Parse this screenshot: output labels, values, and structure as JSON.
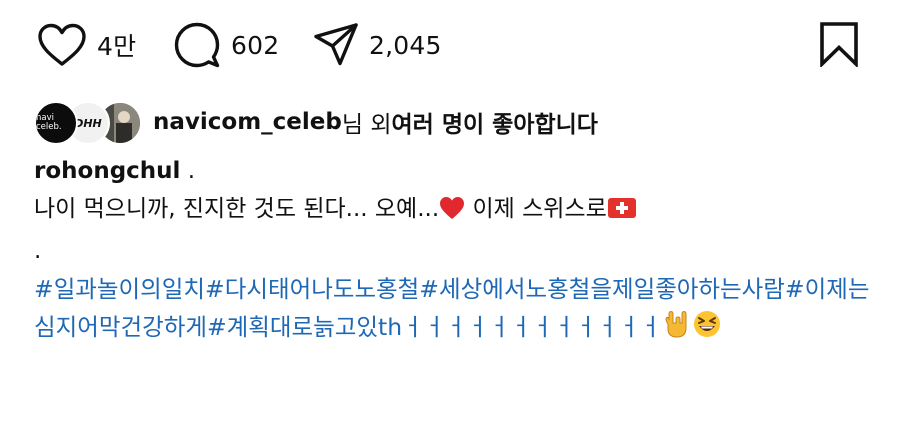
{
  "actions": {
    "like_count": "4만",
    "comment_count": "602",
    "share_count": "2,045"
  },
  "likes": {
    "first_user": "navicom_celeb",
    "suffix_plain": "님 외 ",
    "suffix_bold": "여러 명이 좋아합니다"
  },
  "caption": {
    "username": "rohongchul",
    "username_suffix": " .",
    "line1_text": "나이 먹으니까, 진지한 것도 된다... 오예...",
    "line1_after_heart": " 이제 스위스로",
    "dot_line": ".",
    "hashtags": "#일과놀이의일치#다시태어나도노홍철#세상에서노홍철을제일좋아하는사람#이제는심지어막건강하게#계획대로늙고있th",
    "trailing": "ㅓㅓㅓㅓㅓㅓㅓㅓㅓㅓㅓㅓ"
  },
  "avatar_labels": {
    "first": "navi celeb.",
    "second": "DHH"
  },
  "icons": {
    "like": "heart-icon",
    "comment": "comment-bubble-icon",
    "share": "paper-plane-icon",
    "save": "bookmark-icon"
  },
  "colors": {
    "hashtag": "#1f68b5",
    "text": "#111111",
    "heart_emoji": "#e0282e",
    "swiss_flag": "#e3322b"
  }
}
